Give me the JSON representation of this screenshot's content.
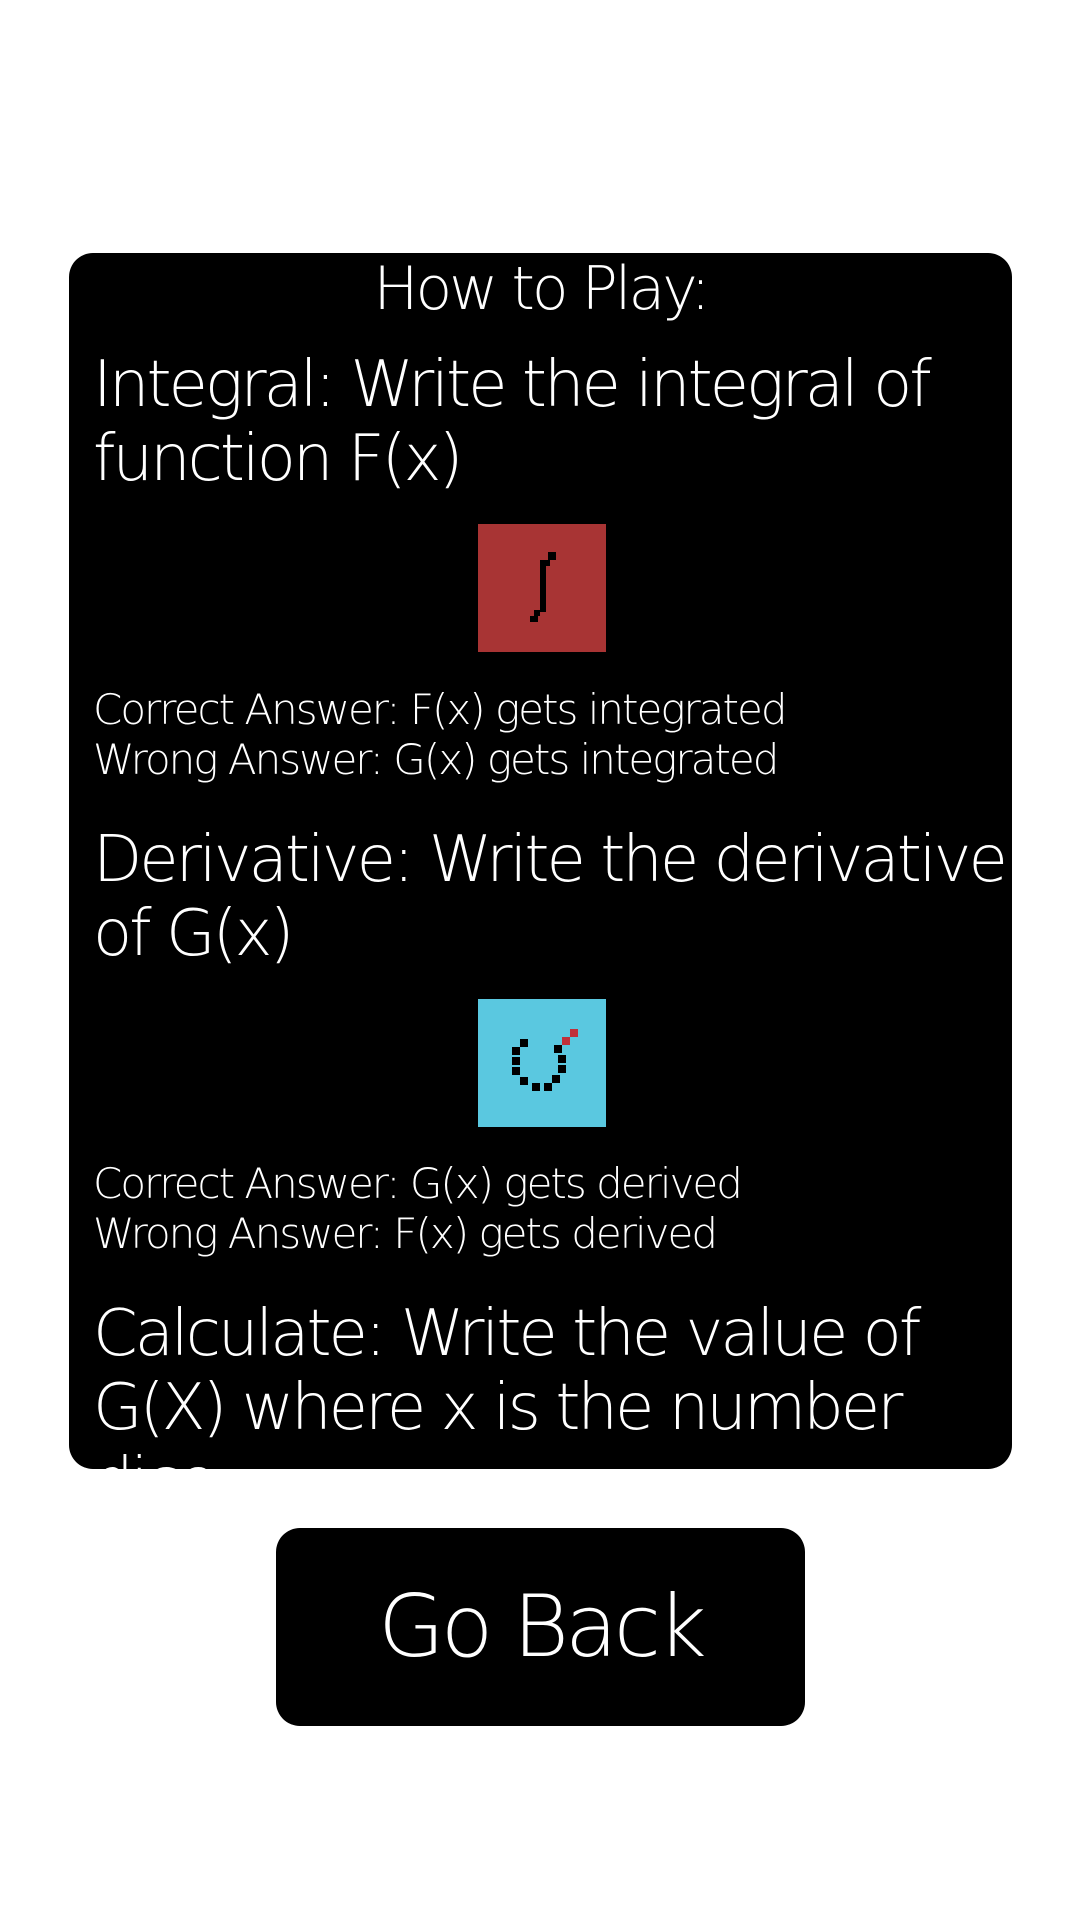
{
  "panel": {
    "title": "How to Play:",
    "integral": {
      "line1": "Integral: Write the integral of",
      "line2": "function F(x)",
      "icon": "integral-icon",
      "color": "#a83434",
      "correct": "Correct Answer: F(x) gets integrated",
      "wrong": "Wrong Answer: G(x) gets integrated"
    },
    "derivative": {
      "line1": "Derivative: Write the derivative",
      "line2": "of G(x)",
      "icon": "derivative-icon",
      "color": "#5ac8e0",
      "correct": "Correct Answer: G(x) gets derived",
      "wrong": "Wrong Answer: F(x) gets derived"
    },
    "calculate": {
      "line1": "Calculate: Write the value of",
      "line2": "G(X) where x is the number",
      "line3": "dice"
    }
  },
  "button": {
    "go_back": "Go Back"
  }
}
